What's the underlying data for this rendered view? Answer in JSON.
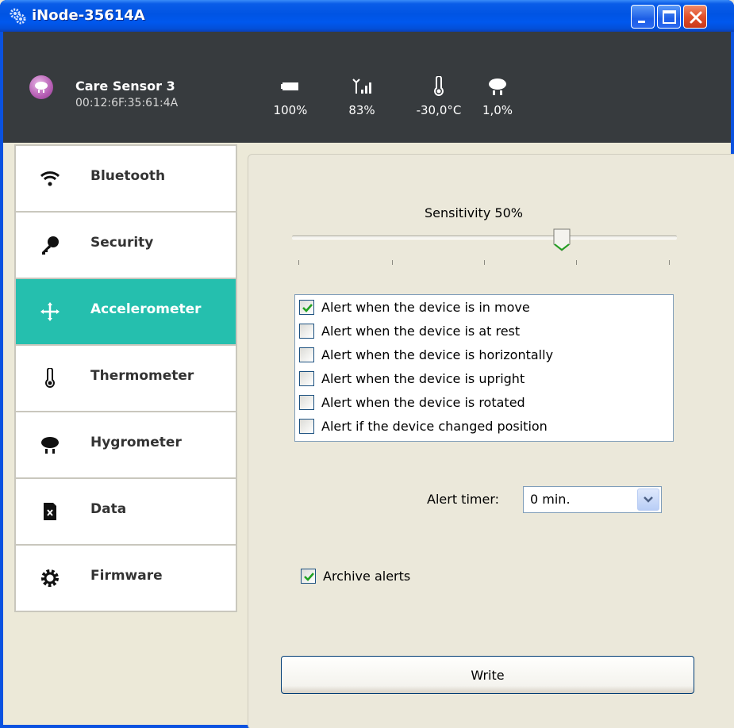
{
  "window": {
    "title": "iNode-35614A"
  },
  "device": {
    "name": "Care Sensor 3",
    "mac": "00:12:6F:35:61:4A"
  },
  "stats": [
    {
      "icon": "battery-icon",
      "value": "100%"
    },
    {
      "icon": "signal-icon",
      "value": "83%"
    },
    {
      "icon": "thermometer-icon",
      "value": "-30,0°C"
    },
    {
      "icon": "rain-cloud-icon",
      "value": "1,0%"
    }
  ],
  "sidebar": {
    "items": [
      {
        "label": "Bluetooth",
        "icon": "wifi-icon",
        "active": false
      },
      {
        "label": "Security",
        "icon": "key-icon",
        "active": false
      },
      {
        "label": "Accelerometer",
        "icon": "move-arrows-icon",
        "active": true
      },
      {
        "label": "Thermometer",
        "icon": "thermometer-icon",
        "active": false
      },
      {
        "label": "Hygrometer",
        "icon": "rain-cloud-icon",
        "active": false
      },
      {
        "label": "Data",
        "icon": "sd-card-icon",
        "active": false
      },
      {
        "label": "Firmware",
        "icon": "gear-icon",
        "active": false
      }
    ]
  },
  "accelerometer": {
    "sensitivity_label": "Sensitivity 50%",
    "sensitivity_value": 0.7,
    "alerts": [
      {
        "label": "Alert when the device is in move",
        "checked": true
      },
      {
        "label": "Alert when the device is at rest",
        "checked": false
      },
      {
        "label": "Alert when the device is horizontally",
        "checked": false
      },
      {
        "label": "Alert when the device is upright",
        "checked": false
      },
      {
        "label": "Alert when the device is rotated",
        "checked": false
      },
      {
        "label": "Alert if the device changed position",
        "checked": false
      }
    ],
    "timer_label": "Alert timer:",
    "timer_value": "0 min.",
    "archive_label": "Archive alerts",
    "archive_checked": true,
    "write_label": "Write"
  },
  "colors": {
    "header_bg": "#373b3e",
    "active_nav": "#25bfae",
    "titlebar": "#0054e3",
    "checkmark": "#21a121"
  }
}
